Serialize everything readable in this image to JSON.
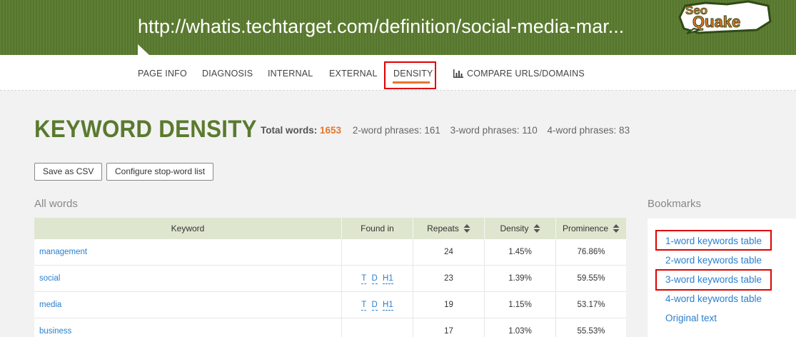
{
  "header": {
    "url": "http://whatis.techtarget.com/definition/social-media-mar...",
    "logo_text": "Seo Quake",
    "bg_color": "#5a7a2e"
  },
  "nav": {
    "items": [
      {
        "label": "PAGE INFO"
      },
      {
        "label": "DIAGNOSIS"
      },
      {
        "label": "INTERNAL"
      },
      {
        "label": "EXTERNAL"
      },
      {
        "label": "DENSITY",
        "active": true
      },
      {
        "label": "COMPARE URLS/DOMAINS",
        "icon": "bar-chart-icon"
      }
    ],
    "active_color": "#e8752a"
  },
  "page": {
    "title": "KEYWORD DENSITY",
    "stats": {
      "total_label": "Total words:",
      "total_value": "1653",
      "two_word": "2-word phrases: 161",
      "three_word": "3-word phrases: 110",
      "four_word": "4-word phrases: 83"
    },
    "buttons": {
      "save_csv": "Save as CSV",
      "configure": "Configure stop-word list"
    },
    "all_words_label": "All words",
    "bookmarks_label": "Bookmarks"
  },
  "table": {
    "headers": {
      "keyword": "Keyword",
      "found_in": "Found in",
      "repeats": "Repeats",
      "density": "Density",
      "prominence": "Prominence"
    },
    "rows": [
      {
        "keyword": "management",
        "found": [],
        "repeats": "24",
        "density": "1.45%",
        "prominence": "76.86%"
      },
      {
        "keyword": "social",
        "found": [
          "T",
          "D",
          "H1"
        ],
        "repeats": "23",
        "density": "1.39%",
        "prominence": "59.55%"
      },
      {
        "keyword": "media",
        "found": [
          "T",
          "D",
          "H1"
        ],
        "repeats": "19",
        "density": "1.15%",
        "prominence": "53.17%"
      },
      {
        "keyword": "business",
        "found": [],
        "repeats": "17",
        "density": "1.03%",
        "prominence": "55.53%"
      }
    ]
  },
  "bookmarks": {
    "items": [
      {
        "label": "1-word keywords table",
        "highlighted": true
      },
      {
        "label": "2-word keywords table",
        "highlighted": false
      },
      {
        "label": "3-word keywords table",
        "highlighted": true
      },
      {
        "label": "4-word keywords table",
        "highlighted": false
      },
      {
        "label": "Original text",
        "highlighted": false
      }
    ],
    "highlight_color": "#e00000"
  }
}
